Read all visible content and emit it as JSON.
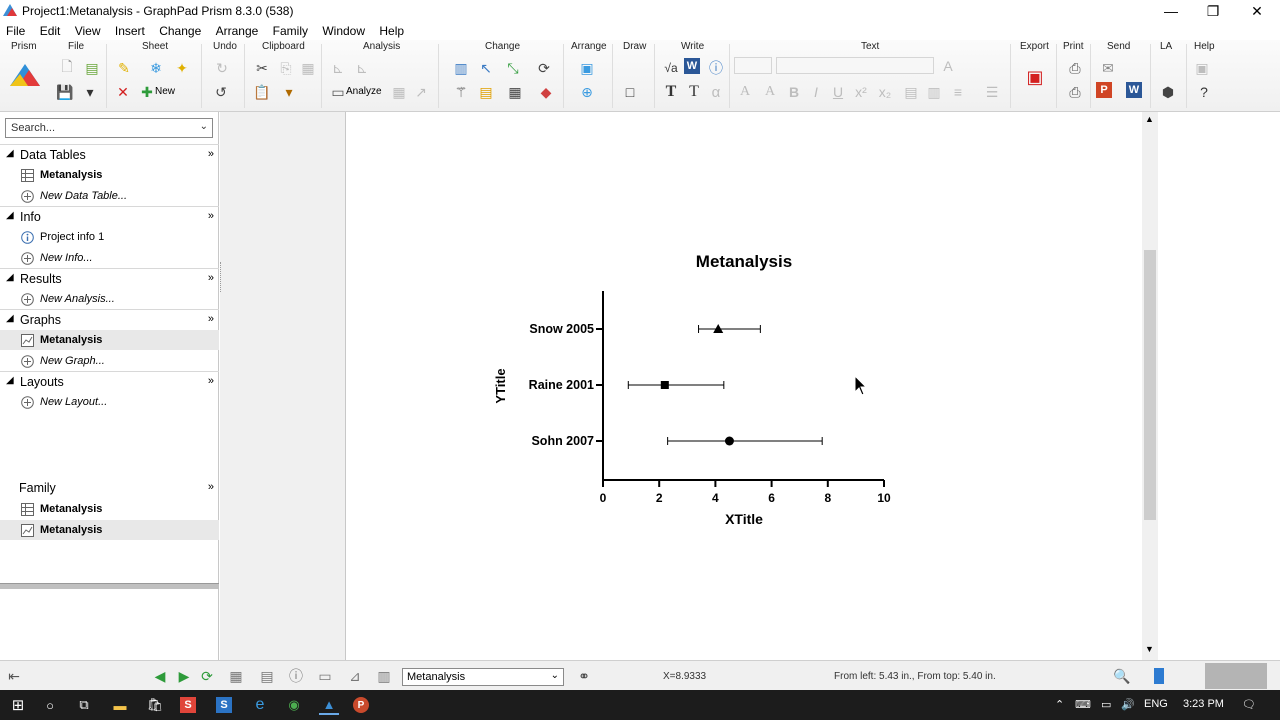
{
  "window": {
    "title": "Project1:Metanalysis - GraphPad Prism 8.3.0 (538)",
    "minimize": "—",
    "restore": "❐",
    "close": "✕"
  },
  "menu": [
    "File",
    "Edit",
    "View",
    "Insert",
    "Change",
    "Arrange",
    "Family",
    "Window",
    "Help"
  ],
  "ribbon": {
    "groups": [
      "Prism",
      "File",
      "Sheet",
      "Undo",
      "Clipboard",
      "Analysis",
      "Change",
      "Arrange",
      "Draw",
      "Write",
      "Text",
      "Export",
      "Print",
      "Send",
      "LA",
      "Help"
    ],
    "new_label": "New",
    "analyze_label": "Analyze"
  },
  "navigator": {
    "search_placeholder": "Search...",
    "sections": [
      {
        "label": "Data Tables",
        "items": [
          {
            "label": "Metanalysis",
            "kind": "bold"
          },
          {
            "label": "New Data Table...",
            "kind": "new"
          }
        ]
      },
      {
        "label": "Info",
        "items": [
          {
            "label": "Project info 1",
            "kind": "info"
          },
          {
            "label": "New Info...",
            "kind": "new"
          }
        ]
      },
      {
        "label": "Results",
        "items": [
          {
            "label": "New Analysis...",
            "kind": "new"
          }
        ]
      },
      {
        "label": "Graphs",
        "items": [
          {
            "label": "Metanalysis",
            "kind": "bold"
          },
          {
            "label": "New Graph...",
            "kind": "new"
          }
        ]
      },
      {
        "label": "Layouts",
        "items": [
          {
            "label": "New Layout...",
            "kind": "new"
          }
        ]
      }
    ],
    "family": {
      "label": "Family",
      "items": [
        {
          "label": "Metanalysis"
        },
        {
          "label": "Metanalysis"
        }
      ]
    }
  },
  "chart_data": {
    "type": "scatter",
    "subtype": "forest-plot",
    "title": "Metanalysis",
    "xlabel": "XTitle",
    "ylabel": "YTitle",
    "xlim": [
      0,
      10
    ],
    "xticks": [
      "0",
      "2",
      "4",
      "6",
      "8",
      "10"
    ],
    "categories": [
      "Snow 2005",
      "Raine  2001",
      "Sohn 2007"
    ],
    "points": [
      {
        "label": "Snow 2005",
        "x": 4.1,
        "low": 3.4,
        "high": 5.6,
        "marker": "triangle"
      },
      {
        "label": "Raine  2001",
        "x": 2.2,
        "low": 0.9,
        "high": 4.3,
        "marker": "square"
      },
      {
        "label": "Sohn 2007",
        "x": 4.5,
        "low": 2.3,
        "high": 7.8,
        "marker": "circle"
      }
    ],
    "grid": false
  },
  "status": {
    "sheet": "Metanalysis",
    "x_readout": "X=8.9333",
    "position": "From left: 5.43 in., From top: 5.40 in."
  },
  "taskbar": {
    "lang": "ENG",
    "time": "3:23 PM"
  }
}
